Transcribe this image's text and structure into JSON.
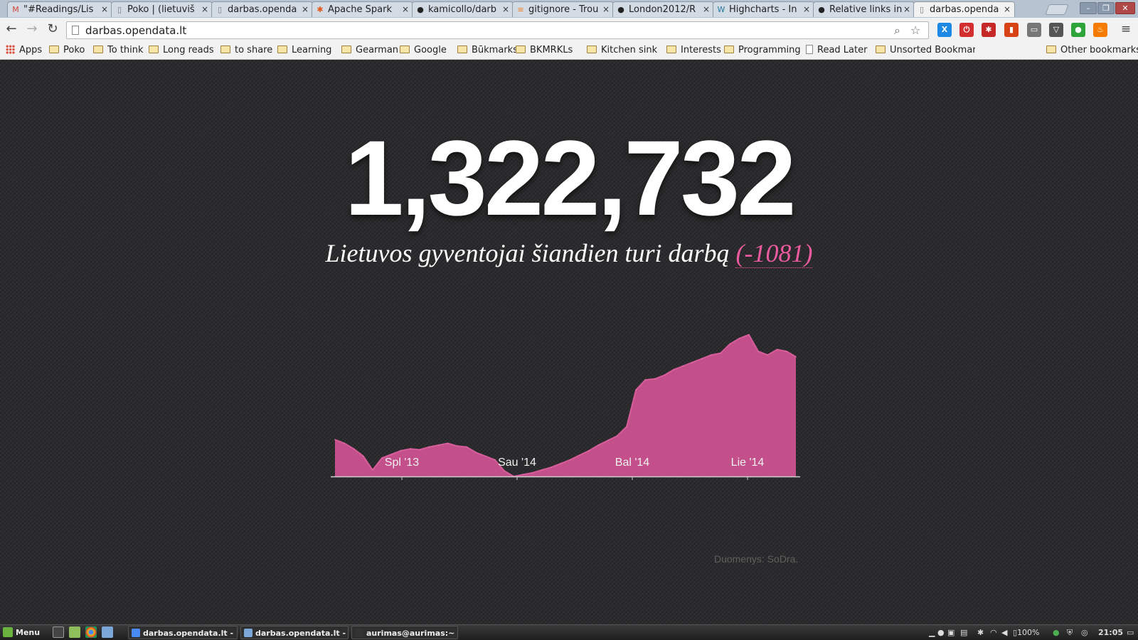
{
  "browser": {
    "tabs": [
      {
        "title": "\"#Readings/Lis",
        "icon": "gmail-icon",
        "color": "#d44638",
        "glyph": "M"
      },
      {
        "title": "Poko | (lietuviš",
        "icon": "page-icon",
        "color": "#777",
        "glyph": "▯"
      },
      {
        "title": "darbas.openda",
        "icon": "page-icon",
        "color": "#777",
        "glyph": "▯"
      },
      {
        "title": "Apache Spark",
        "icon": "spark-icon",
        "color": "#e25a1c",
        "glyph": "✱"
      },
      {
        "title": "kamicollo/darb",
        "icon": "github-icon",
        "color": "#222",
        "glyph": "●"
      },
      {
        "title": "gitignore - Trou",
        "icon": "stackoverflow-icon",
        "color": "#f48024",
        "glyph": "≡"
      },
      {
        "title": "London2012/R",
        "icon": "github-icon",
        "color": "#222",
        "glyph": "●"
      },
      {
        "title": "Highcharts - In",
        "icon": "wordpress-icon",
        "color": "#21759b",
        "glyph": "W"
      },
      {
        "title": "Relative links in",
        "icon": "github-icon",
        "color": "#222",
        "glyph": "●"
      },
      {
        "title": "darbas.openda",
        "icon": "page-icon",
        "color": "#777",
        "glyph": "▯",
        "active": true
      }
    ],
    "url": "darbas.opendata.lt",
    "bookmarks": [
      {
        "label": "Apps",
        "type": "apps"
      },
      {
        "label": "Poko",
        "type": "folder"
      },
      {
        "label": "To think",
        "type": "folder"
      },
      {
        "label": "Long reads",
        "type": "folder"
      },
      {
        "label": "to share",
        "type": "folder"
      },
      {
        "label": "Learning",
        "type": "folder"
      },
      {
        "label": "Gearman",
        "type": "folder"
      },
      {
        "label": "Google",
        "type": "folder"
      },
      {
        "label": "Būkmarks",
        "type": "folder"
      },
      {
        "label": "BKMRKLs",
        "type": "folder"
      },
      {
        "label": "Kitchen sink",
        "type": "folder"
      },
      {
        "label": "Interests",
        "type": "folder"
      },
      {
        "label": "Programming",
        "type": "folder"
      },
      {
        "label": "Read Later",
        "type": "page"
      },
      {
        "label": "Unsorted Bookmark",
        "type": "folder"
      },
      {
        "label": "Other bookmarks",
        "type": "folder"
      }
    ],
    "extensions": [
      {
        "name": "x-extension-icon",
        "color": "#1e88e5",
        "glyph": "X"
      },
      {
        "name": "adblock-icon",
        "color": "#d32f2f",
        "glyph": "⏻"
      },
      {
        "name": "lastpass-icon",
        "color": "#c62828",
        "glyph": "✱"
      },
      {
        "name": "bookmark-ext-icon",
        "color": "#d84315",
        "glyph": "▮"
      },
      {
        "name": "cast-icon",
        "color": "#777",
        "glyph": "▭"
      },
      {
        "name": "pocket-icon",
        "color": "#555",
        "glyph": "▽"
      },
      {
        "name": "evernote-icon",
        "color": "#2ea43a",
        "glyph": "●"
      },
      {
        "name": "fire-icon",
        "color": "#f57c00",
        "glyph": "♨"
      }
    ]
  },
  "page": {
    "headline_number": "1,322,732",
    "subtitle": "Lietuvos gyventojai šiandien turi darbą",
    "delta": "(-1081)",
    "source": "Duomenys: SoDra."
  },
  "chart_data": {
    "type": "area",
    "color": "#c4508b",
    "x_tick_labels": [
      "Spl '13",
      "Sau '14",
      "Bal '14",
      "Lie '14"
    ],
    "x_tick_positions": [
      0.145,
      0.395,
      0.645,
      0.895
    ],
    "ylim": [
      1265000,
      1345000
    ],
    "grid": false,
    "values": [
      1285000,
      1283000,
      1280000,
      1276000,
      1268500,
      1275000,
      1277000,
      1279000,
      1280000,
      1279500,
      1281000,
      1282000,
      1283000,
      1281500,
      1281000,
      1278000,
      1276000,
      1274000,
      1268000,
      1265000,
      1266000,
      1267000,
      1268500,
      1270000,
      1272000,
      1274000,
      1276500,
      1279000,
      1282000,
      1284500,
      1287000,
      1292000,
      1312000,
      1317500,
      1318000,
      1320000,
      1323000,
      1325000,
      1327000,
      1329000,
      1331000,
      1332000,
      1337000,
      1340000,
      1342000,
      1333000,
      1331000,
      1334000,
      1333000,
      1330000
    ]
  },
  "taskbar": {
    "menu_label": "Menu",
    "tasks": [
      "darbas.opendata.lt - ...",
      "darbas.opendata.lt - ...",
      "aurimas@aurimas:~"
    ],
    "battery": "100%",
    "clock": "21:05"
  }
}
